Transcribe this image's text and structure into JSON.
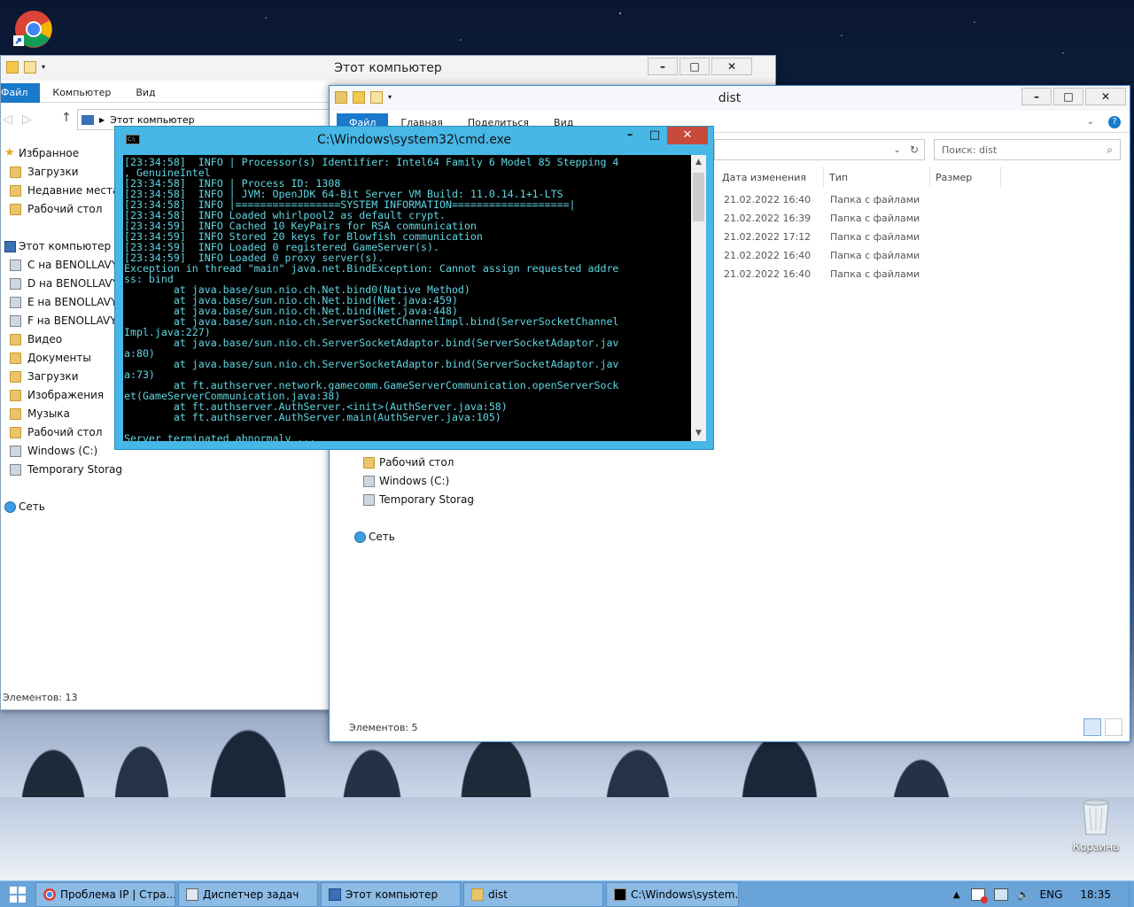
{
  "desktop": {
    "recycle_bin_label": "Корзина"
  },
  "explorer_back": {
    "title": "Этот компьютер",
    "ribbon_tabs": [
      "Файл",
      "Компьютер",
      "Вид"
    ],
    "address": "Этот компьютер",
    "nav_items": [
      {
        "label": "Избранное",
        "icon": "star-icon"
      },
      {
        "label": "Загрузки",
        "icon": "folder-icon"
      },
      {
        "label": "Недавние места",
        "icon": "folder-icon"
      },
      {
        "label": "Рабочий стол",
        "icon": "folder-icon"
      },
      {
        "label": "Этот компьютер",
        "icon": "computer-icon"
      },
      {
        "label": "C на BENOLLAVY",
        "icon": "network-drive-icon"
      },
      {
        "label": "D на BENOLLAVY",
        "icon": "network-drive-icon"
      },
      {
        "label": "E на BENOLLAVY",
        "icon": "network-drive-icon"
      },
      {
        "label": "F на BENOLLAVY",
        "icon": "network-drive-icon"
      },
      {
        "label": "Видео",
        "icon": "folder-icon"
      },
      {
        "label": "Документы",
        "icon": "folder-icon"
      },
      {
        "label": "Загрузки",
        "icon": "folder-icon"
      },
      {
        "label": "Изображения",
        "icon": "folder-icon"
      },
      {
        "label": "Музыка",
        "icon": "folder-icon"
      },
      {
        "label": "Рабочий стол",
        "icon": "folder-icon"
      },
      {
        "label": "Windows (C:)",
        "icon": "drive-icon"
      },
      {
        "label": "Temporary Storage (",
        "icon": "drive-icon"
      },
      {
        "label": "Сеть",
        "icon": "network-icon"
      }
    ],
    "status": "Элементов: 13"
  },
  "explorer_dist": {
    "title": "dist",
    "ribbon_tabs": [
      "Файл",
      "Главная",
      "Поделиться",
      "Вид"
    ],
    "search_placeholder": "Поиск: dist",
    "columns": [
      "Дата изменения",
      "Тип",
      "Размер"
    ],
    "rows": [
      {
        "date": "21.02.2022 16:40",
        "type": "Папка с файлами"
      },
      {
        "date": "21.02.2022 16:39",
        "type": "Папка с файлами"
      },
      {
        "date": "21.02.2022 17:12",
        "type": "Папка с файлами"
      },
      {
        "date": "21.02.2022 16:40",
        "type": "Папка с файлами"
      },
      {
        "date": "21.02.2022 16:40",
        "type": "Папка с файлами"
      }
    ],
    "nav_items": [
      {
        "label": "Рабочий стол",
        "icon": "folder-icon"
      },
      {
        "label": "Windows (C:)",
        "icon": "drive-icon"
      },
      {
        "label": "Temporary Storage (",
        "icon": "drive-icon"
      },
      {
        "label": "Сеть",
        "icon": "network-icon"
      }
    ],
    "status": "Элементов: 5"
  },
  "cmd": {
    "title": "C:\\Windows\\system32\\cmd.exe",
    "lines": [
      "[23:34:58]  INFO | Processor(s) Identifier: Intel64 Family 6 Model 85 Stepping 4",
      ", GenuineIntel",
      "[23:34:58]  INFO | Process ID: 1308",
      "[23:34:58]  INFO | JVM: OpenJDK 64-Bit Server VM Build: 11.0.14.1+1-LTS",
      "[23:34:58]  INFO |=================SYSTEM INFORMATION===================|",
      "[23:34:58]  INFO Loaded whirlpool2 as default crypt.",
      "[23:34:59]  INFO Cached 10 KeyPairs for RSA communication",
      "[23:34:59]  INFO Stored 20 keys for Blowfish communication",
      "[23:34:59]  INFO Loaded 0 registered GameServer(s).",
      "[23:34:59]  INFO Loaded 0 proxy server(s).",
      "Exception in thread \"main\" java.net.BindException: Cannot assign requested addre",
      "ss: bind",
      "        at java.base/sun.nio.ch.Net.bind0(Native Method)",
      "        at java.base/sun.nio.ch.Net.bind(Net.java:459)",
      "        at java.base/sun.nio.ch.Net.bind(Net.java:448)",
      "        at java.base/sun.nio.ch.ServerSocketChannelImpl.bind(ServerSocketChannel",
      "Impl.java:227)",
      "        at java.base/sun.nio.ch.ServerSocketAdaptor.bind(ServerSocketAdaptor.jav",
      "a:80)",
      "        at java.base/sun.nio.ch.ServerSocketAdaptor.bind(ServerSocketAdaptor.jav",
      "a:73)",
      "        at ft.authserver.network.gamecomm.GameServerCommunication.openServerSock",
      "et(GameServerCommunication.java:38)",
      "        at ft.authserver.AuthServer.<init>(AuthServer.java:58)",
      "        at ft.authserver.AuthServer.main(AuthServer.java:105)",
      "",
      "Server terminated abnormaly ..."
    ]
  },
  "taskbar": {
    "tasks": [
      {
        "label": "Проблема IP | Стра...",
        "icon": "chrome-icon"
      },
      {
        "label": "Диспетчер задач",
        "icon": "task-manager-icon"
      },
      {
        "label": "Этот компьютер",
        "icon": "computer-icon"
      },
      {
        "label": "dist",
        "icon": "folder-icon"
      },
      {
        "label": "C:\\Windows\\system...",
        "icon": "cmd-icon"
      }
    ],
    "language": "ENG",
    "time": "18:35"
  }
}
